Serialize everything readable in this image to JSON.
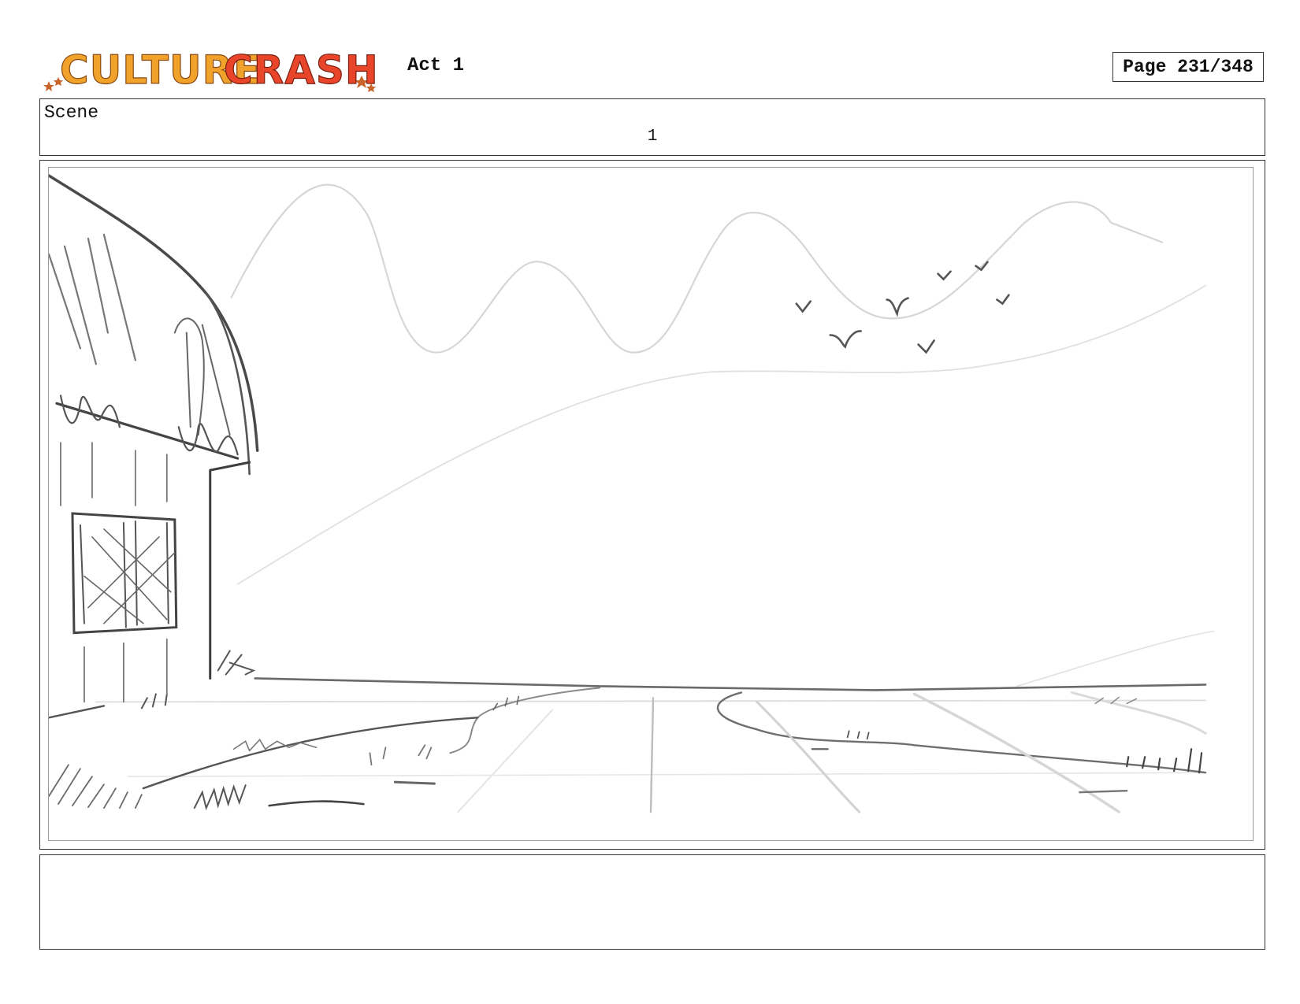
{
  "header": {
    "logo_text": "CULTURE CRASH",
    "act": "Act 1",
    "page": "Page 231/348"
  },
  "scene": {
    "label": "Scene",
    "number": "1"
  },
  "notes": {
    "text": ""
  },
  "colors": {
    "logo_orange": "#f0a22a",
    "logo_red": "#e8452a",
    "sketch_dark": "#3a3a3a",
    "sketch_light": "#c8c8c8"
  }
}
